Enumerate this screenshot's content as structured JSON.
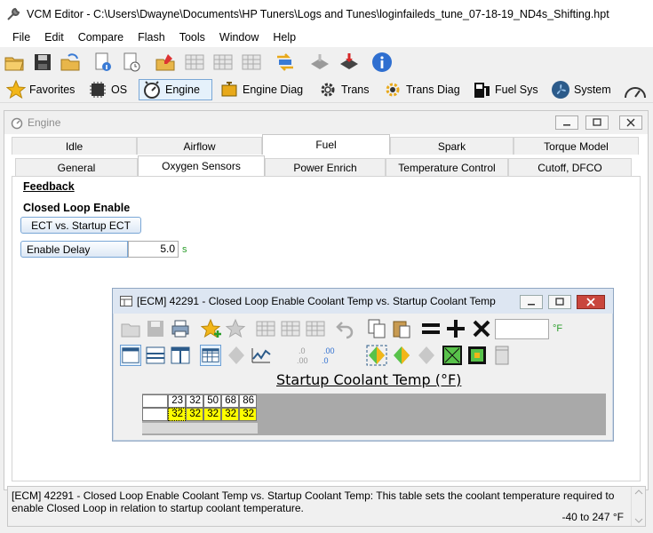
{
  "app": {
    "title": "VCM Editor - C:\\Users\\Dwayne\\Documents\\HP Tuners\\Logs and Tunes\\loginfaileds_tune_07-18-19_ND4s_Shifting.hpt"
  },
  "menu": [
    "File",
    "Edit",
    "Compare",
    "Flash",
    "Tools",
    "Window",
    "Help"
  ],
  "toolbar_categories": [
    {
      "label": "Favorites",
      "icon": "star-icon"
    },
    {
      "label": "OS",
      "icon": "chip-icon"
    },
    {
      "label": "Engine",
      "icon": "engine-icon",
      "active": true
    },
    {
      "label": "Engine Diag",
      "icon": "engine-diag-icon"
    },
    {
      "label": "Trans",
      "icon": "gear-icon"
    },
    {
      "label": "Trans Diag",
      "icon": "gear-diag-icon"
    },
    {
      "label": "Fuel Sys",
      "icon": "fuel-pump-icon"
    },
    {
      "label": "System",
      "icon": "fan-icon"
    }
  ],
  "engine_window": {
    "title": "Engine",
    "tabs_row1": [
      "Idle",
      "Airflow",
      "Fuel",
      "Spark",
      "Torque Model"
    ],
    "tabs_row1_selected": "Fuel",
    "tabs_row2": [
      "General",
      "Oxygen Sensors",
      "Power Enrich",
      "Temperature Control",
      "Cutoff, DFCO"
    ],
    "tabs_row2_selected": "Oxygen Sensors",
    "section_title": "Feedback",
    "group_title": "Closed Loop Enable",
    "ect_button": "ECT vs. Startup ECT",
    "enable_delay_label": "Enable Delay",
    "enable_delay_value": "5.0",
    "enable_delay_unit": "s"
  },
  "table_window": {
    "title": "[ECM] 42291 - Closed Loop Enable Coolant Temp vs. Startup Coolant Temp",
    "unit": "°F",
    "axis_title": "Startup Coolant Temp (°F)",
    "header": [
      "23",
      "32",
      "50",
      "68",
      "86"
    ],
    "values": [
      "32",
      "32",
      "32",
      "32",
      "32"
    ]
  },
  "status": {
    "description": "[ECM] 42291 - Closed Loop Enable Coolant Temp vs. Startup Coolant Temp: This table sets the coolant temperature required to enable Closed Loop in relation to startup coolant temperature.",
    "range": "-40 to 247 °F"
  }
}
